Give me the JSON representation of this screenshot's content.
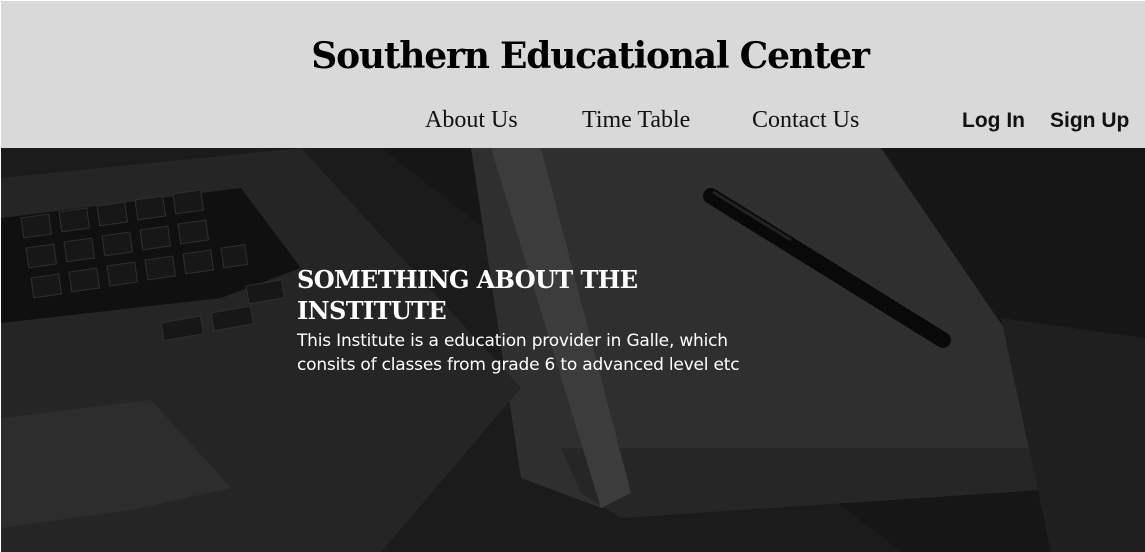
{
  "site": {
    "title": "Southern Educational Center"
  },
  "nav": {
    "items": [
      {
        "label": "About Us"
      },
      {
        "label": "Time Table"
      },
      {
        "label": "Contact Us"
      }
    ],
    "auth": {
      "login_label": "Log In",
      "signup_label": "Sign Up"
    }
  },
  "hero": {
    "heading": "SOMETHING ABOUT THE INSTITUTE",
    "body": "This Institute is a education provider in Galle, which consits of classes from grade 6 to advanced level etc"
  },
  "colors": {
    "header_bg": "#d9d9d9",
    "hero_text": "#ffffff",
    "nav_text": "#111111"
  }
}
